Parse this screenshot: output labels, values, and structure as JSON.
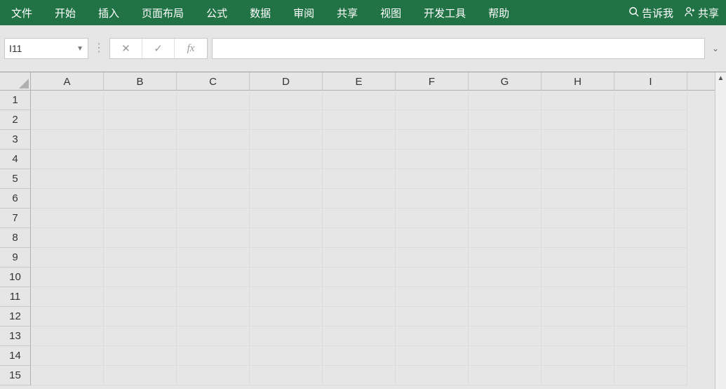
{
  "ribbon": {
    "tabs": [
      "文件",
      "开始",
      "插入",
      "页面布局",
      "公式",
      "数据",
      "审阅",
      "共享",
      "视图",
      "开发工具",
      "帮助"
    ],
    "tell_me": "告诉我",
    "share": "共享"
  },
  "formula_bar": {
    "name_box": "I11",
    "cancel": "✕",
    "enter": "✓",
    "fx": "fx",
    "formula_value": ""
  },
  "grid": {
    "columns": [
      "A",
      "B",
      "C",
      "D",
      "E",
      "F",
      "G",
      "H",
      "I"
    ],
    "rows": [
      "1",
      "2",
      "3",
      "4",
      "5",
      "6",
      "7",
      "8",
      "9",
      "10",
      "11",
      "12",
      "13",
      "14",
      "15"
    ],
    "active_cell": "I11"
  },
  "colors": {
    "ribbon_bg": "#217346",
    "header_bg": "#e6e6e6",
    "gridline": "#dcdcdc"
  }
}
